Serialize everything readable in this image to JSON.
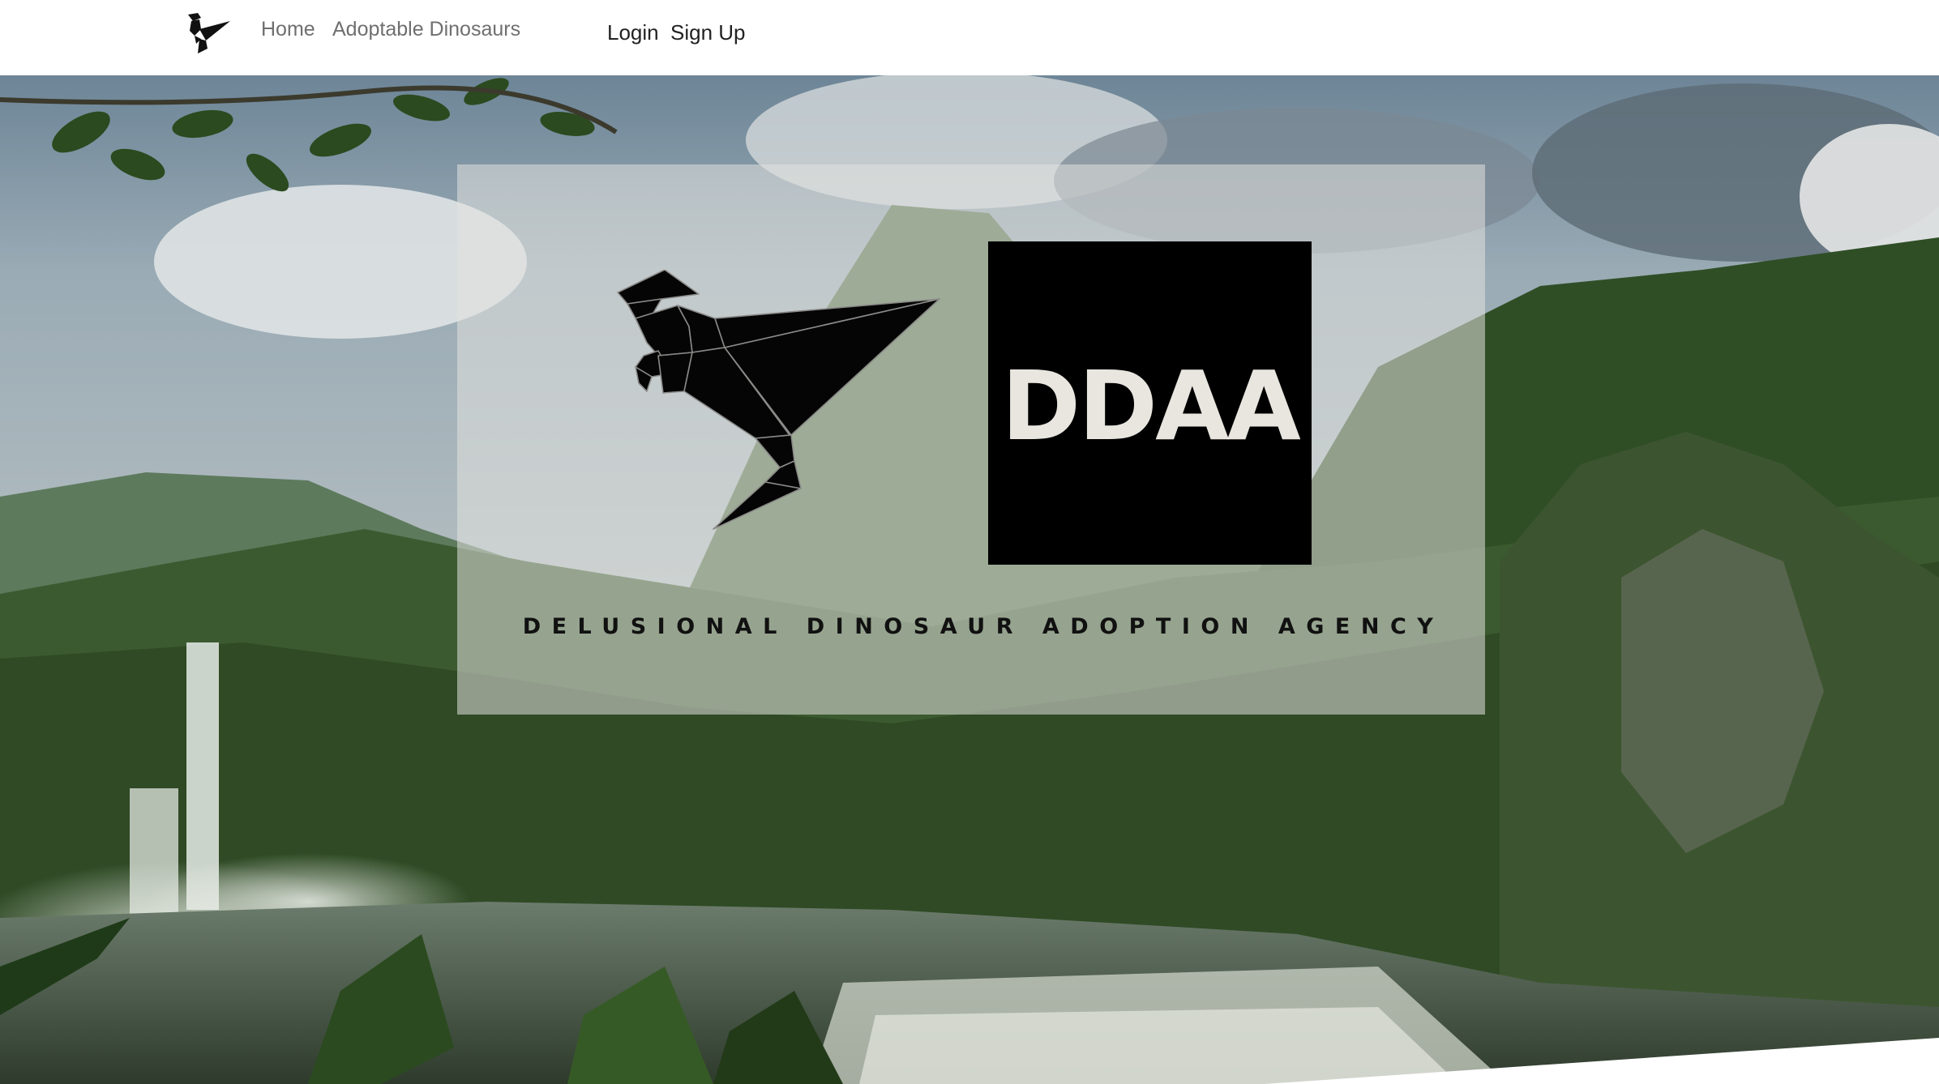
{
  "nav": {
    "brand_icon": "raptor-icon",
    "home_label": "Home",
    "adoptable_label": "Adoptable Dinosaurs",
    "login_label": "Login",
    "signup_label": "Sign Up"
  },
  "hero": {
    "logo_text": "DDAA",
    "tagline": "DELUSIONAL DINOSAUR ADOPTION AGENCY",
    "logo_icon": "origami-raptor-icon"
  },
  "colors": {
    "nav_link": "#6f6f6f",
    "nav_auth": "#222222",
    "logo_box": "#000000",
    "logo_text": "#e8e6df"
  }
}
